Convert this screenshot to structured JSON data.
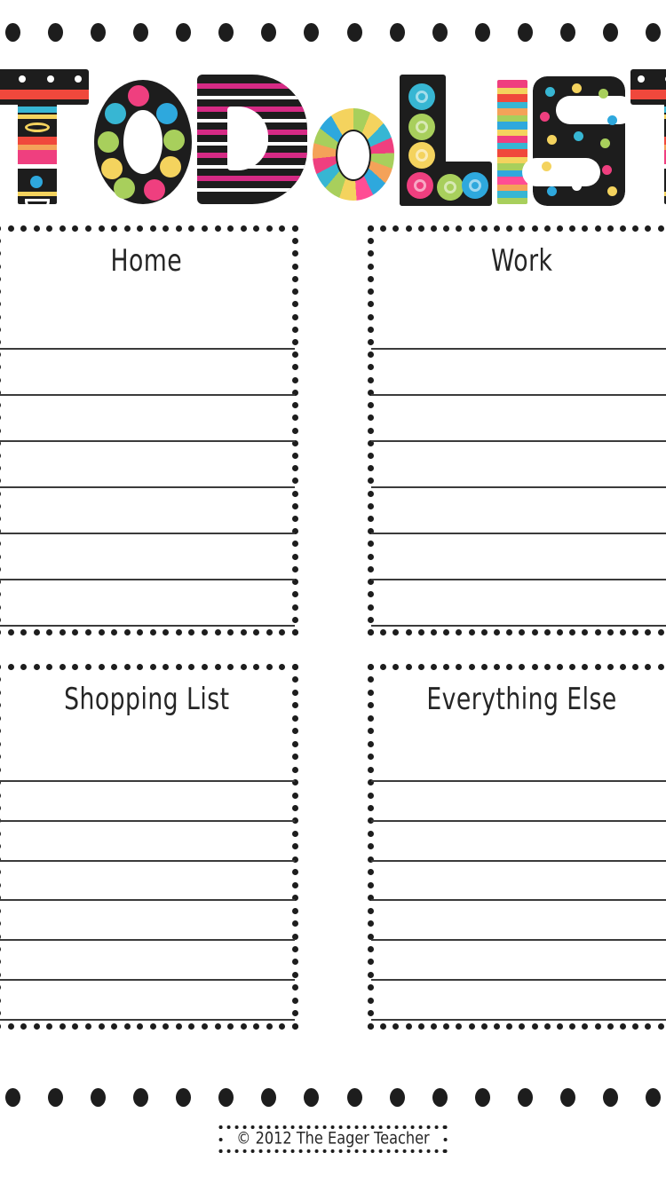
{
  "document": {
    "title": "TO DO LIST",
    "title_letters": [
      {
        "char": "T",
        "style": "striped-red-dots"
      },
      {
        "char": "O",
        "style": "polka-spots"
      },
      {
        "char": "D",
        "style": "pink-stripes"
      },
      {
        "char": "o",
        "style": "rainbow-wedges"
      },
      {
        "char": "L",
        "style": "spiral-spots"
      },
      {
        "char": "I",
        "style": "horizontal-stripes"
      },
      {
        "char": "S",
        "style": "confetti-dots"
      },
      {
        "char": "T",
        "style": "striped-red-dots"
      }
    ],
    "background_color": "#ffffff",
    "ink_color": "#1d1d1d",
    "rule_color": "#3b3b3b"
  },
  "borders": {
    "top_dot_count": 16,
    "bottom_dot_count": 16,
    "dot_color": "#1d1d1d"
  },
  "sections": [
    {
      "id": "home",
      "heading": "Home",
      "line_count": 7
    },
    {
      "id": "work",
      "heading": "Work",
      "line_count": 7
    },
    {
      "id": "shopping",
      "heading": "Shopping List",
      "line_count": 7
    },
    {
      "id": "everything",
      "heading": "Everything Else",
      "line_count": 7
    }
  ],
  "footer": {
    "credit": "© 2012 The Eager Teacher"
  },
  "palette": {
    "red": "#f0483c",
    "pink": "#ef3f7f",
    "magenta": "#d62a85",
    "hot_pink": "#ff4d94",
    "teal": "#37b6d3",
    "blue": "#2ea8dd",
    "green": "#a8cf5c",
    "yellow": "#f4d35e",
    "orange": "#f4a259",
    "purple": "#8e6fb5",
    "white": "#ffffff",
    "black": "#1d1d1d"
  }
}
